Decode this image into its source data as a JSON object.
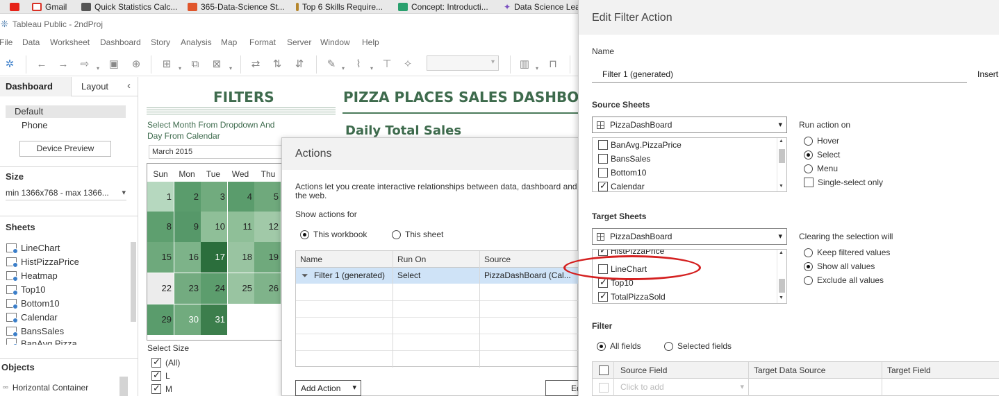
{
  "bookmarks": [
    {
      "label": "",
      "icon": "youtube-icon",
      "color": "#e62117"
    },
    {
      "label": "Gmail",
      "icon": "gmail-icon",
      "color": "#d93025"
    },
    {
      "label": "Quick Statistics Calc...",
      "icon": "calculator-icon",
      "color": "#555555"
    },
    {
      "label": "365-Data-Science St...",
      "icon": "calendar-icon",
      "color": "#e0552b"
    },
    {
      "label": "Top 6 Skills Require...",
      "icon": "bookmark-icon",
      "color": "#b5862c"
    },
    {
      "label": "Concept: Introducti...",
      "icon": "d-logo-icon",
      "color": "#2aa06e"
    },
    {
      "label": "Data Science Lea",
      "icon": "star-logo-icon",
      "color": "#7a4fc0"
    }
  ],
  "app": {
    "title": "Tableau Public - 2ndProj"
  },
  "menu": [
    "File",
    "Data",
    "Worksheet",
    "Dashboard",
    "Story",
    "Analysis",
    "Map",
    "Format",
    "Server",
    "Window",
    "Help"
  ],
  "left_pane": {
    "tabs": {
      "dashboard": "Dashboard",
      "layout": "Layout"
    },
    "devices": [
      "Default",
      "Phone"
    ],
    "device_preview": "Device Preview",
    "size_heading": "Size",
    "size_value": "min 1366x768 - max 1366...",
    "sheets_heading": "Sheets",
    "sheets": [
      "LineChart",
      "HistPizzaPrice",
      "Heatmap",
      "Top10",
      "Bottom10",
      "Calendar",
      "BansSales",
      "BanAvg.Pizza..."
    ],
    "objects_heading": "Objects",
    "objects": [
      "Horizontal Container"
    ]
  },
  "dashboard": {
    "filters_title": "FILTERS",
    "main_title": "PIZZA PLACES SALES DASHBOARD",
    "filter_instructions": "Select Month From Dropdown And Day From Calendar",
    "month_value": "March 2015",
    "daily_title": "Daily Total Sales",
    "calendar_headers": [
      "Sun",
      "Mon",
      "Tue",
      "Wed",
      "Thu"
    ],
    "calendar_days": [
      {
        "day": "1",
        "color": "#b6d8bf"
      },
      {
        "day": "2",
        "color": "#5a9c6c"
      },
      {
        "day": "3",
        "color": "#71ab7e"
      },
      {
        "day": "4",
        "color": "#5a9c6c"
      },
      {
        "day": "5",
        "color": "#6fa97c"
      },
      {
        "day": "8",
        "color": "#5e9f6f"
      },
      {
        "day": "9",
        "color": "#569869"
      },
      {
        "day": "10",
        "color": "#8fbf98"
      },
      {
        "day": "11",
        "color": "#8fbf98"
      },
      {
        "day": "12",
        "color": "#a1c9a8"
      },
      {
        "day": "15",
        "color": "#6ea97c"
      },
      {
        "day": "16",
        "color": "#7db389"
      },
      {
        "day": "17",
        "color": "#2b6e3c"
      },
      {
        "day": "18",
        "color": "#99c4a1"
      },
      {
        "day": "19",
        "color": "#6fa97c"
      },
      {
        "day": "22",
        "color": "#ececec"
      },
      {
        "day": "23",
        "color": "#73ab80"
      },
      {
        "day": "24",
        "color": "#5c9d6d"
      },
      {
        "day": "25",
        "color": "#99c4a1"
      },
      {
        "day": "26",
        "color": "#7fb38a"
      },
      {
        "day": "29",
        "color": "#5a9c6c"
      },
      {
        "day": "30",
        "color": "#71ab7e"
      },
      {
        "day": "31",
        "color": "#3c7e4c"
      }
    ],
    "size_label": "Select Size",
    "size_options": [
      {
        "label": "(All)",
        "checked": true
      },
      {
        "label": "L",
        "checked": true
      },
      {
        "label": "M",
        "checked": true
      }
    ]
  },
  "actions_dialog": {
    "title": "Actions",
    "description": "Actions let you create interactive relationships between data, dashboard and the web.",
    "show_for_label": "Show actions for",
    "scope_options": [
      {
        "label": "This workbook",
        "selected": true
      },
      {
        "label": "This sheet",
        "selected": false
      }
    ],
    "columns": [
      "Name",
      "Run On",
      "Source"
    ],
    "rows": [
      {
        "name": "Filter 1 (generated)",
        "run_on": "Select",
        "source": "PizzaDashBoard (Cal..."
      }
    ],
    "add_action": "Add Action",
    "edit": "Ed"
  },
  "edit_filter_dialog": {
    "title": "Edit Filter Action",
    "name_label": "Name",
    "name_value": "Filter 1 (generated)",
    "insert_label": "Insert",
    "source_heading": "Source Sheets",
    "source_dashboard": "PizzaDashBoard",
    "source_sheets": [
      {
        "label": "BanAvg.PizzaPrice",
        "checked": false
      },
      {
        "label": "BansSales",
        "checked": false
      },
      {
        "label": "Bottom10",
        "checked": false
      },
      {
        "label": "Calendar",
        "checked": true
      }
    ],
    "run_on_heading": "Run action on",
    "run_on_options": [
      {
        "label": "Hover",
        "selected": false
      },
      {
        "label": "Select",
        "selected": true
      },
      {
        "label": "Menu",
        "selected": false
      }
    ],
    "single_select_label": "Single-select only",
    "target_heading": "Target Sheets",
    "target_dashboard": "PizzaDashBoard",
    "target_sheets": [
      {
        "label": "HistPizzaPrice",
        "checked": true
      },
      {
        "label": "LineChart",
        "checked": false
      },
      {
        "label": "Top10",
        "checked": true
      },
      {
        "label": "TotalPizzaSold",
        "checked": true
      }
    ],
    "clearing_heading": "Clearing the selection will",
    "clearing_options": [
      {
        "label": "Keep filtered values",
        "selected": false
      },
      {
        "label": "Show all values",
        "selected": true
      },
      {
        "label": "Exclude all values",
        "selected": false
      }
    ],
    "filter_heading": "Filter",
    "filter_options": [
      {
        "label": "All fields",
        "selected": true
      },
      {
        "label": "Selected fields",
        "selected": false
      }
    ],
    "field_columns": [
      "Source Field",
      "Target Data Source",
      "Target Field"
    ],
    "click_to_add": "Click to add"
  },
  "annotation": {
    "color": "#d42020"
  }
}
